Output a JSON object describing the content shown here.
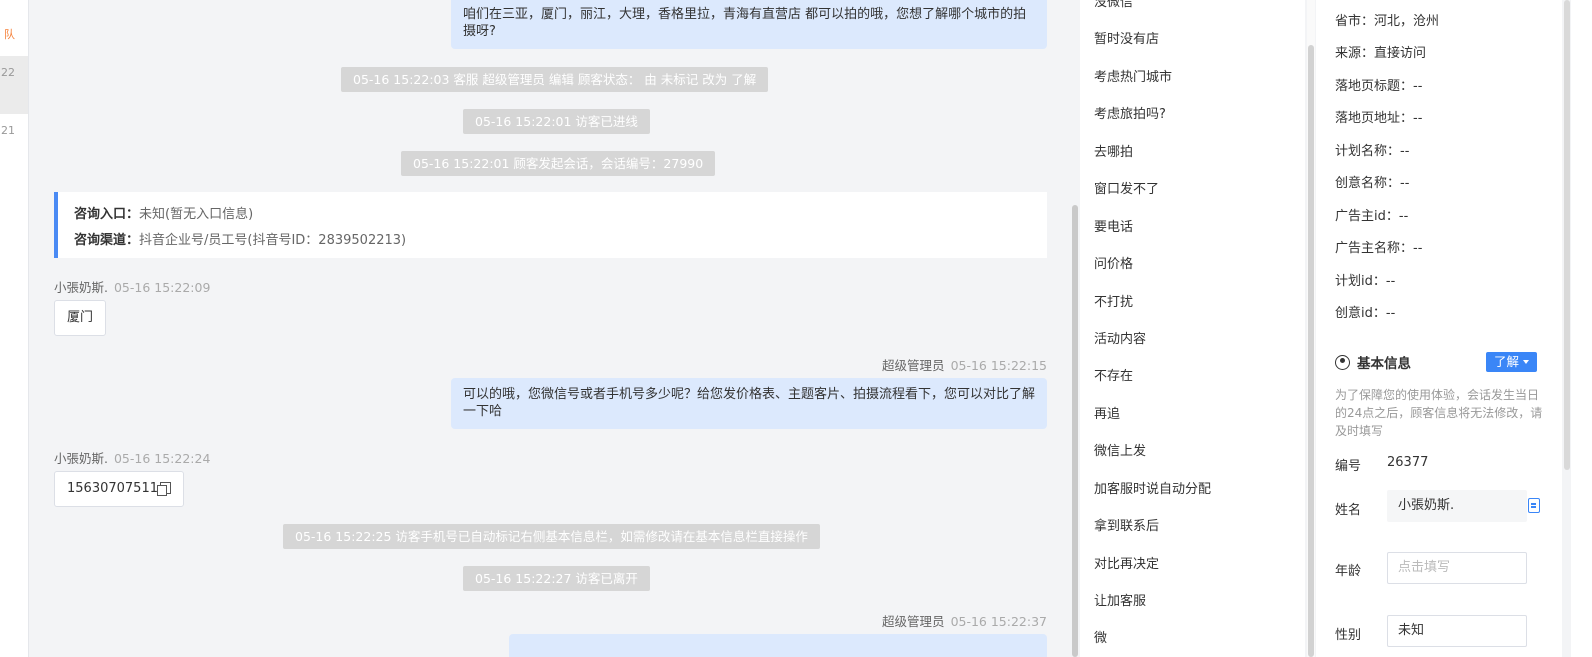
{
  "session_list": {
    "items": [
      {
        "text": "队"
      },
      {
        "text": "22"
      },
      {
        "text": "21"
      }
    ]
  },
  "chat": {
    "messages": [
      {
        "kind": "agent_bubble",
        "text": "咱们在三亚，厦门，丽江，大理，香格里拉，青海有直营店 都可以拍的哦，您想了解哪个城市的拍摄呀?"
      },
      {
        "kind": "system",
        "text": "05-16 15:22:03 客服 超级管理员 编辑 顾客状态： 由 未标记 改为 了解"
      },
      {
        "kind": "system",
        "text": "05-16 15:22:01 访客已进线"
      },
      {
        "kind": "system",
        "text": "05-16 15:22:01 顾客发起会话，会话编号：27990"
      },
      {
        "kind": "visitor_name",
        "name": "小張奶斯.",
        "time": "05-16 15:22:09"
      },
      {
        "kind": "visitor_bubble",
        "text": "厦门"
      },
      {
        "kind": "agent_name",
        "name": "超级管理员",
        "time": "05-16 15:22:15"
      },
      {
        "kind": "agent_bubble",
        "text": "可以的哦，您微信号或者手机号多少呢？给您发价格表、主题客片、拍摄流程看下，您可以对比了解一下哈"
      },
      {
        "kind": "visitor_name",
        "name": "小張奶斯.",
        "time": "05-16 15:22:24"
      },
      {
        "kind": "visitor_bubble",
        "text": "15630707511"
      },
      {
        "kind": "system",
        "text": "05-16 15:22:25 访客手机号已自动标记右侧基本信息栏，如需修改请在基本信息栏直接操作"
      },
      {
        "kind": "system",
        "text": "05-16 15:22:27 访客已离开"
      },
      {
        "kind": "agent_name",
        "name": "超级管理员",
        "time": "05-16 15:22:37"
      }
    ],
    "info_card": {
      "entry_label": "咨询入口：",
      "entry_value": "未知(暂无入口信息)",
      "channel_label": "咨询渠道：",
      "channel_value": "抖音企业号/员工号(抖音号ID：2839502213)"
    }
  },
  "quick_replies": [
    "没微信",
    "暂时没有店",
    "考虑热门城市",
    "考虑旅拍吗?",
    "去哪拍",
    "窗口发不了",
    "要电话",
    "问价格",
    "不打扰",
    "活动内容",
    "不存在",
    "再追",
    "微信上发",
    "加客服时说自动分配",
    "拿到联系后",
    "对比再决定",
    "让加客服",
    "微"
  ],
  "customer": {
    "attributes": [
      {
        "label": "省市：",
        "value": "河北，沧州"
      },
      {
        "label": "来源：",
        "value": "直接访问"
      },
      {
        "label": "落地页标题：",
        "value": "--"
      },
      {
        "label": "落地页地址：",
        "value": "--"
      },
      {
        "label": "计划名称：",
        "value": "--"
      },
      {
        "label": "创意名称：",
        "value": "--"
      },
      {
        "label": "广告主id：",
        "value": "--"
      },
      {
        "label": "广告主名称：",
        "value": "--"
      },
      {
        "label": "计划id：",
        "value": "--"
      },
      {
        "label": "创意id：",
        "value": "--"
      }
    ],
    "basic_info": {
      "title": "基本信息",
      "status_button": "了解",
      "notice": "为了保障您的使用体验，会话发生当日的24点之后，顾客信息将无法修改，请及时填写",
      "id_label": "编号",
      "id_value": "26377",
      "name_label": "姓名",
      "name_value": "小張奶斯.",
      "age_label": "年龄",
      "age_placeholder": "点击填写",
      "gender_label": "性别",
      "gender_value": "未知"
    },
    "accent_color": "#3a86f7"
  }
}
